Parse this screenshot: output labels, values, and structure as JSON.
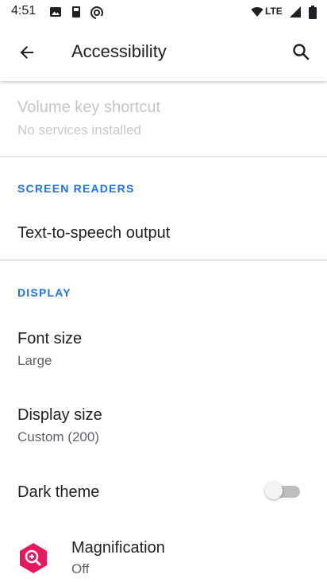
{
  "status_bar": {
    "time": "4:51",
    "network": "LTE",
    "icons": [
      "photo-notification-icon",
      "media-notification-icon",
      "sync-notification-icon",
      "wifi-icon",
      "lte-signal-icon",
      "battery-icon"
    ]
  },
  "app_bar": {
    "title": "Accessibility",
    "back_icon": "arrow-back-icon",
    "search_icon": "search-icon"
  },
  "items": {
    "volume_shortcut": {
      "title": "Volume key shortcut",
      "subtitle": "No services installed",
      "enabled": false
    },
    "tts_output": {
      "title": "Text-to-speech output"
    },
    "font_size": {
      "title": "Font size",
      "subtitle": "Large"
    },
    "display_size": {
      "title": "Display size",
      "subtitle": "Custom (200)"
    },
    "dark_theme": {
      "title": "Dark theme",
      "toggle_on": false
    },
    "magnification": {
      "title": "Magnification",
      "subtitle": "Off",
      "icon": "magnification-icon"
    }
  },
  "sections": {
    "screen_readers": "SCREEN READERS",
    "display": "DISPLAY"
  },
  "colors": {
    "accent": "#1a73e8",
    "magnification_icon": "#e8185c",
    "primary_text": "#202124",
    "secondary_text": "#5f6368"
  }
}
